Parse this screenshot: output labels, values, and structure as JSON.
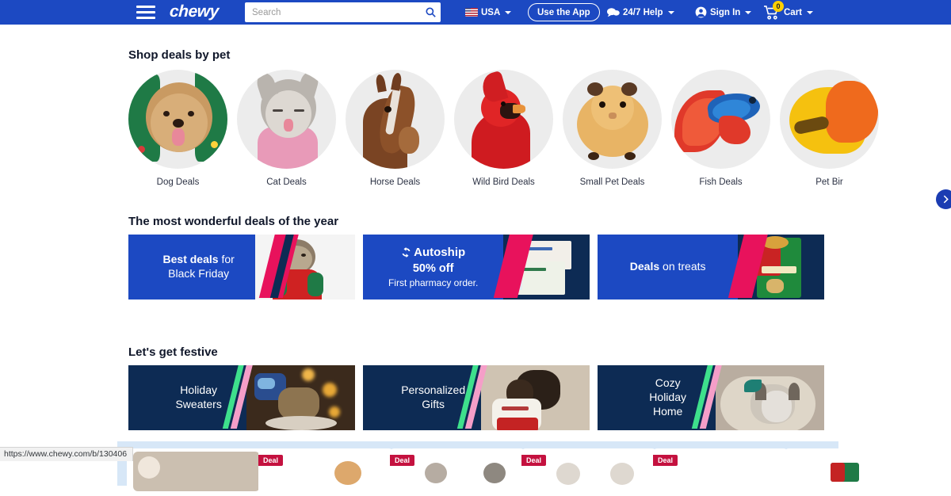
{
  "header": {
    "menu_icon": "hamburger-icon",
    "logo_text": "chewy",
    "search": {
      "value": "",
      "placeholder": "Search",
      "icon": "search-icon"
    },
    "region": {
      "label": "USA",
      "icon": "us-flag-icon"
    },
    "app_button": "Use the App",
    "help": {
      "label": "24/7 Help",
      "icon": "chat-bubble-icon"
    },
    "signin": {
      "label": "Sign In",
      "icon": "account-icon"
    },
    "cart": {
      "label": "Cart",
      "count": "0",
      "icon": "cart-icon"
    },
    "accent_color": "#1c49c2",
    "badge_color": "#ffcf00"
  },
  "pets_section": {
    "title": "Shop deals by pet",
    "next_icon": "chevron-right-icon",
    "items": [
      {
        "label": "Dog Deals",
        "image": "poodle-in-green-christmas-sweater"
      },
      {
        "label": "Cat Deals",
        "image": "cat-in-pink-sweater-licking"
      },
      {
        "label": "Horse Deals",
        "image": "brown-horse-head"
      },
      {
        "label": "Wild Bird Deals",
        "image": "red-cardinal-bird"
      },
      {
        "label": "Small Pet Deals",
        "image": "tan-guinea-pig"
      },
      {
        "label": "Fish Deals",
        "image": "blue-red-betta-fish"
      },
      {
        "label": "Pet Bir",
        "image": "yellow-parrot"
      }
    ]
  },
  "deals_section": {
    "title": "The most wonderful deals of the year",
    "banners": [
      {
        "line1_bold": "Best deals",
        "line1_rest": " for",
        "line2": "Black Friday",
        "bg": "#1c49c2",
        "image": "cat-in-red-green-christmas-sweater"
      },
      {
        "eyebrow_icon": "autoship-refresh-icon",
        "eyebrow": "Autoship",
        "line1_bold": "50% off",
        "line2": "First pharmacy order.",
        "bg": "#1c49c2",
        "image": "simparica-trio-and-heartgard-combo-boxes"
      },
      {
        "line1_bold": "Deals",
        "line1_rest": " on treats",
        "bg": "#1c49c2",
        "image": "greenies-original-treats-gift-box"
      }
    ]
  },
  "festive_section": {
    "title": "Let's get festive",
    "banners": [
      {
        "lines": [
          "Holiday",
          "Sweaters"
        ],
        "bg": "#0d2b54",
        "image": "cat-sleeping-by-holiday-lights"
      },
      {
        "lines": [
          "Personalized",
          "Gifts"
        ],
        "bg": "#0d2b54",
        "image": "dog-with-nugget-stocking"
      },
      {
        "lines": [
          "Cozy",
          "Holiday",
          "Home"
        ],
        "bg": "#0d2b54",
        "image": "dog-in-plush-bed-with-toy"
      }
    ]
  },
  "deal_strip": {
    "badge_label": "Deal",
    "badge_color": "#c4113f",
    "background": "#d7e7f7",
    "cards": [
      {
        "badge": false,
        "image": "product-thumb-1"
      },
      {
        "badge": true,
        "image": "product-thumb-2"
      },
      {
        "badge": true,
        "image": "product-thumb-3"
      },
      {
        "badge": true,
        "image": "product-thumb-4"
      },
      {
        "badge": true,
        "image": "product-thumb-5"
      },
      {
        "badge": false,
        "image": "product-thumb-6"
      }
    ]
  },
  "status_bar": {
    "url": "https://www.chewy.com/b/130406"
  }
}
